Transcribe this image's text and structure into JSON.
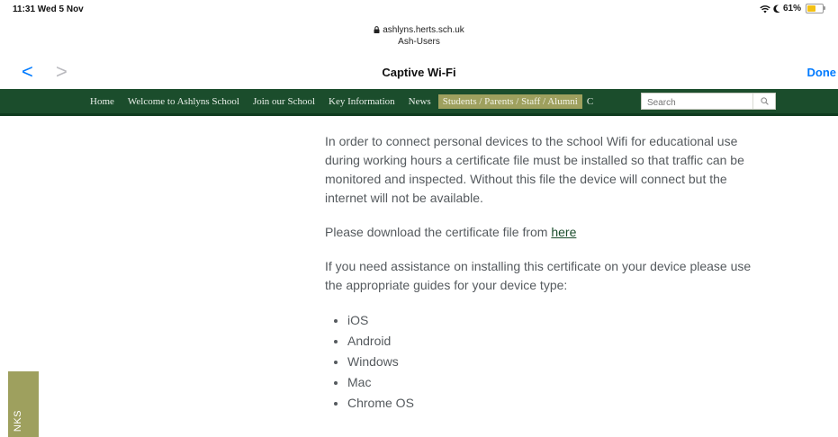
{
  "status_bar": {
    "time": "11:31  Wed 5 Nov",
    "battery": "61%",
    "battery_level": 0.61
  },
  "browser": {
    "url": "ashlyns.herts.sch.uk",
    "subtitle": "Ash-Users",
    "title": "Captive Wi-Fi",
    "back_glyph": "<",
    "forward_glyph": ">",
    "done_label": "Done"
  },
  "menu": {
    "items": [
      "Home",
      "Welcome to Ashlyns School",
      "Join our School",
      "Key Information",
      "News",
      "Students / Parents / Staff / Alumni",
      "C"
    ],
    "active_index": 5,
    "search_placeholder": "Search"
  },
  "content": {
    "para1": "In order to connect personal devices to the school Wifi for educational use during working hours a certificate file must be installed so that traffic can be monitored and inspected. Without this file the device will connect but the internet will not be available.",
    "para2_prefix": "Please download the certificate file from ",
    "para2_link": "here",
    "para3": "If you need assistance on installing this certificate on your device please use the appropriate guides for your device type:",
    "guides": [
      "iOS",
      "Android",
      "Windows",
      "Mac",
      "Chrome OS"
    ]
  },
  "side_tab": {
    "label": "NKS"
  },
  "colors": {
    "menu_bg": "#1b4d2c",
    "accent_olive": "#9ea05e",
    "ios_blue": "#007aff",
    "body_text": "#555a5e"
  }
}
